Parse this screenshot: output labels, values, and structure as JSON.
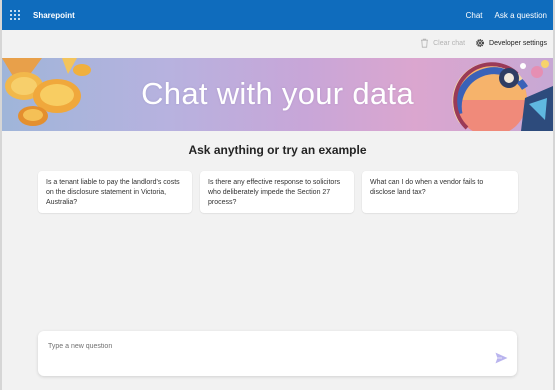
{
  "header": {
    "app_name": "Sharepoint",
    "nav": {
      "chat": "Chat",
      "ask": "Ask a question"
    }
  },
  "commands": {
    "clear_chat": "Clear chat",
    "developer_settings": "Developer settings"
  },
  "banner": {
    "title": "Chat with your data"
  },
  "prompt": {
    "heading": "Ask anything or try an example"
  },
  "examples": [
    "Is a tenant liable to pay the landlord's costs on the disclosure statement in Victoria, Australia?",
    "Is there any effective response to solicitors who deliberately impede the Section 27 process?",
    "What can I do when a vendor fails to disclose land tax?"
  ],
  "question_input": {
    "placeholder": "Type a new question",
    "value": ""
  },
  "colors": {
    "topbar": "#0f6cbd",
    "background": "#f2f2f2",
    "send_icon": "#b9b4ee"
  },
  "icons": {
    "app_launcher": "waffle-icon",
    "clear_chat": "trash-icon",
    "developer_settings": "gear-icon",
    "send": "send-icon"
  }
}
